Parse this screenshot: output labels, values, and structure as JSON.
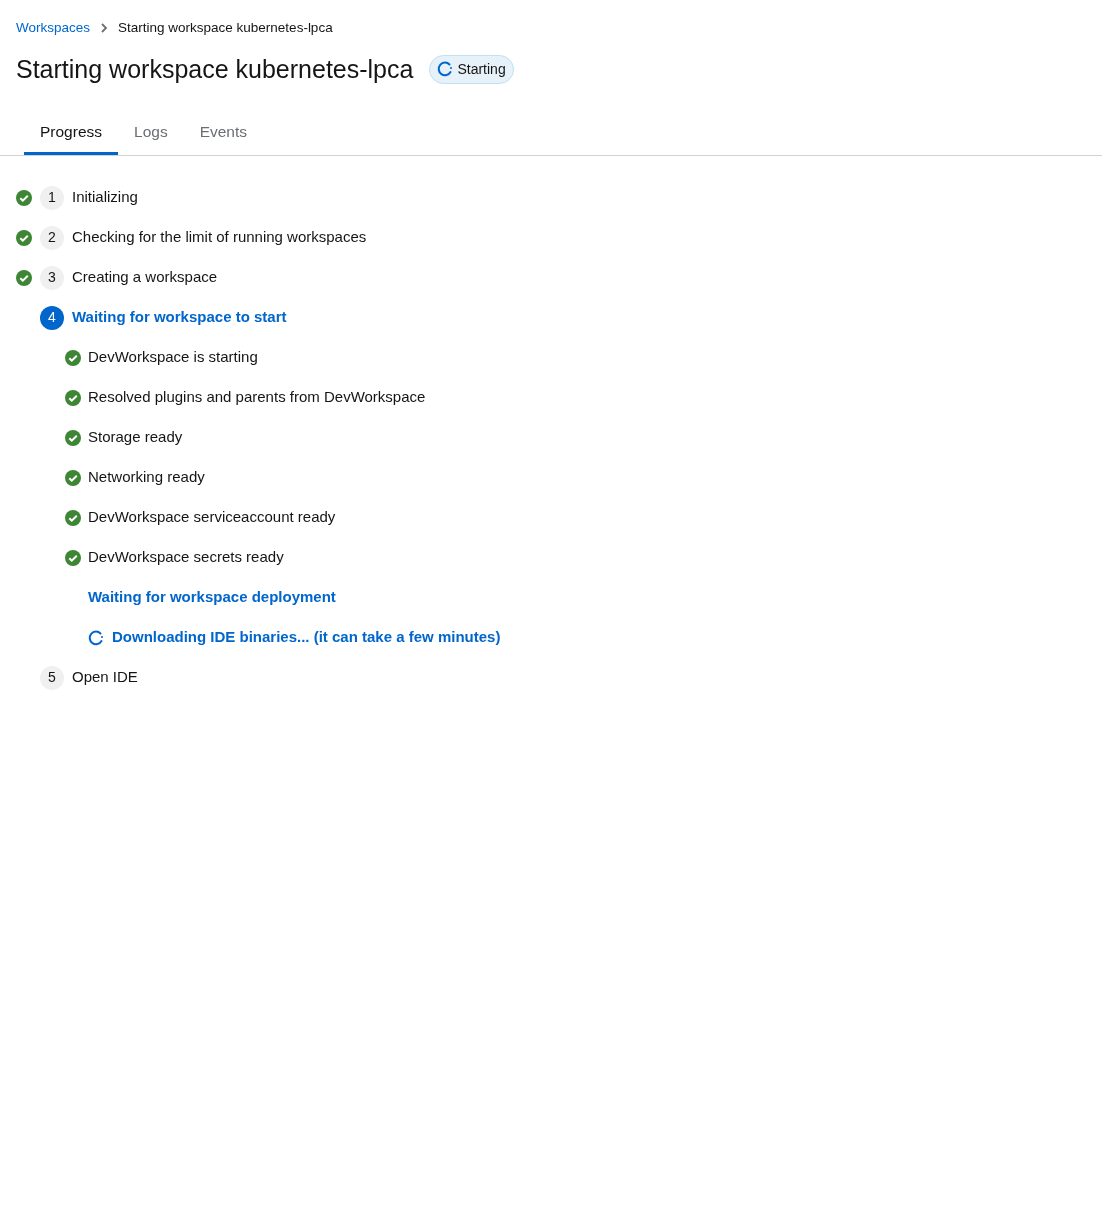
{
  "breadcrumb": [
    {
      "label": "Workspaces",
      "kind": "link"
    },
    {
      "label": "Starting workspace kubernetes-lpca",
      "kind": "current"
    }
  ],
  "title": "Starting workspace kubernetes-lpca",
  "status_badge": {
    "label": "Starting"
  },
  "tabs": [
    {
      "label": "Progress",
      "selected": true
    },
    {
      "label": "Logs",
      "selected": false
    },
    {
      "label": "Events",
      "selected": false
    }
  ],
  "steps": [
    {
      "number": "1",
      "label": "Initializing",
      "kind": "done"
    },
    {
      "number": "2",
      "label": "Checking for the limit of running workspaces",
      "kind": "done"
    },
    {
      "number": "3",
      "label": "Creating a workspace",
      "kind": "done"
    },
    {
      "number": "4",
      "label": "Waiting for workspace to start",
      "kind": "active",
      "children": [
        {
          "label": "DevWorkspace is starting",
          "kind": "done"
        },
        {
          "label": "Resolved plugins and parents from DevWorkspace",
          "kind": "done"
        },
        {
          "label": "Storage ready",
          "kind": "done"
        },
        {
          "label": "Networking ready",
          "kind": "done"
        },
        {
          "label": "DevWorkspace serviceaccount ready",
          "kind": "done"
        },
        {
          "label": "DevWorkspace secrets ready",
          "kind": "done"
        },
        {
          "label": "Waiting for workspace deployment",
          "kind": "active"
        },
        {
          "label": "Downloading IDE binaries... (it can take a few minutes)",
          "kind": "loading"
        }
      ]
    },
    {
      "number": "5",
      "label": "Open IDE",
      "kind": "pending"
    }
  ]
}
